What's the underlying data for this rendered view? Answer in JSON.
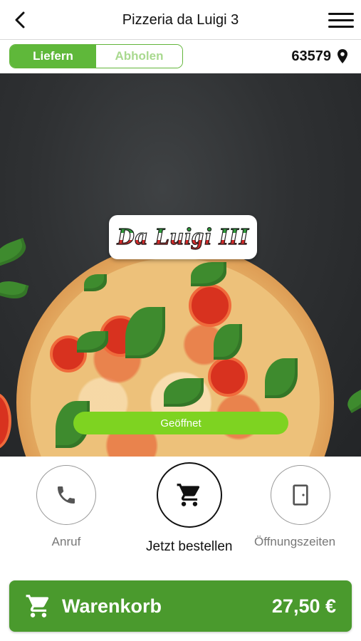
{
  "header": {
    "title": "Pizzeria da Luigi 3",
    "back_icon": "chevron-left-icon",
    "menu_icon": "hamburger-menu-icon"
  },
  "mode": {
    "options": [
      "Liefern",
      "Abholen"
    ],
    "selected": "Liefern"
  },
  "location": {
    "zip": "63579",
    "icon": "map-pin-icon"
  },
  "hero": {
    "logo_text": "Da Luigi III",
    "status": "Geöffnet"
  },
  "actions": [
    {
      "label": "Anruf",
      "icon": "phone-icon"
    },
    {
      "label": "Jetzt bestellen",
      "icon": "cart-icon"
    },
    {
      "label": "Öffnungszeiten",
      "icon": "door-icon"
    }
  ],
  "cart": {
    "label": "Warenkorb",
    "total": "27,50 €",
    "icon": "cart-icon"
  },
  "colors": {
    "brand_green": "#5fb83a",
    "status_green": "#7ed321",
    "cart_green": "#4a9a2d"
  }
}
